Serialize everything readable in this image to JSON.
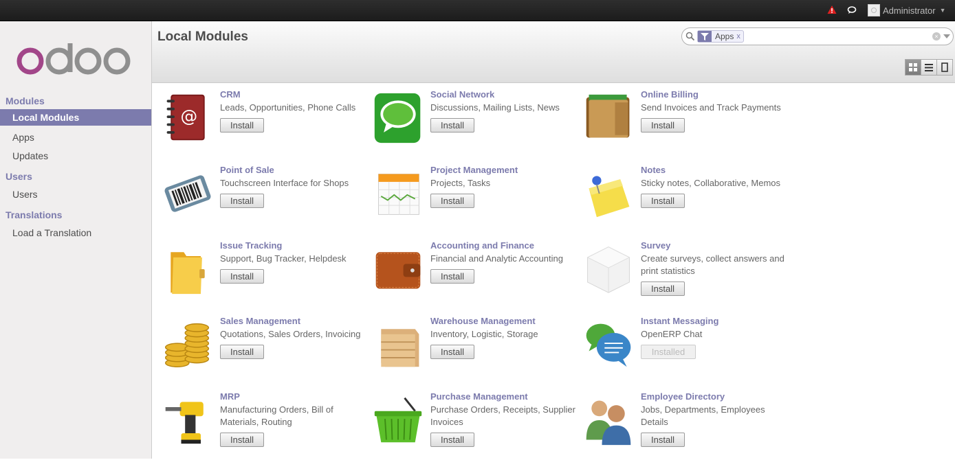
{
  "topbar": {
    "user_name": "Administrator"
  },
  "sidebar": {
    "sections": [
      {
        "title": "Modules",
        "items": [
          "Local Modules",
          "Apps",
          "Updates"
        ]
      },
      {
        "title": "Users",
        "items": [
          "Users"
        ]
      },
      {
        "title": "Translations",
        "items": [
          "Load a Translation"
        ]
      }
    ],
    "active_item": "Local Modules"
  },
  "header": {
    "title": "Local Modules",
    "search": {
      "facet_label": "Apps",
      "value": ""
    }
  },
  "modules": [
    {
      "name": "CRM",
      "desc": "Leads, Opportunities, Phone Calls",
      "button": "Install",
      "icon": "address-book-icon"
    },
    {
      "name": "Social Network",
      "desc": "Discussions, Mailing Lists, News",
      "button": "Install",
      "icon": "speech-bubble-icon"
    },
    {
      "name": "Online Billing",
      "desc": "Send Invoices and Track Payments",
      "button": "Install",
      "icon": "wallet-icon"
    },
    {
      "name": "Point of Sale",
      "desc": "Touchscreen Interface for Shops",
      "button": "Install",
      "icon": "barcode-scanner-icon"
    },
    {
      "name": "Project Management",
      "desc": "Projects, Tasks",
      "button": "Install",
      "icon": "calendar-icon"
    },
    {
      "name": "Notes",
      "desc": "Sticky notes, Collaborative, Memos",
      "button": "Install",
      "icon": "sticky-note-icon"
    },
    {
      "name": "Issue Tracking",
      "desc": "Support, Bug Tracker, Helpdesk",
      "button": "Install",
      "icon": "folder-icon"
    },
    {
      "name": "Accounting and Finance",
      "desc": "Financial and Analytic Accounting",
      "button": "Install",
      "icon": "leather-wallet-icon"
    },
    {
      "name": "Survey",
      "desc": "Create surveys, collect answers and print statistics",
      "button": "Install",
      "icon": "cube-icon"
    },
    {
      "name": "Sales Management",
      "desc": "Quotations, Sales Orders, Invoicing",
      "button": "Install",
      "icon": "coins-icon"
    },
    {
      "name": "Warehouse Management",
      "desc": "Inventory, Logistic, Storage",
      "button": "Install",
      "icon": "crate-icon"
    },
    {
      "name": "Instant Messaging",
      "desc": "OpenERP Chat",
      "button": "Installed",
      "icon": "chat-bubbles-icon"
    },
    {
      "name": "MRP",
      "desc": "Manufacturing Orders, Bill of Materials, Routing",
      "button": "Install",
      "icon": "drill-icon"
    },
    {
      "name": "Purchase Management",
      "desc": "Purchase Orders, Receipts, Supplier Invoices",
      "button": "Install",
      "icon": "basket-icon"
    },
    {
      "name": "Employee Directory",
      "desc": "Jobs, Departments, Employees Details",
      "button": "Install",
      "icon": "people-icon"
    }
  ]
}
